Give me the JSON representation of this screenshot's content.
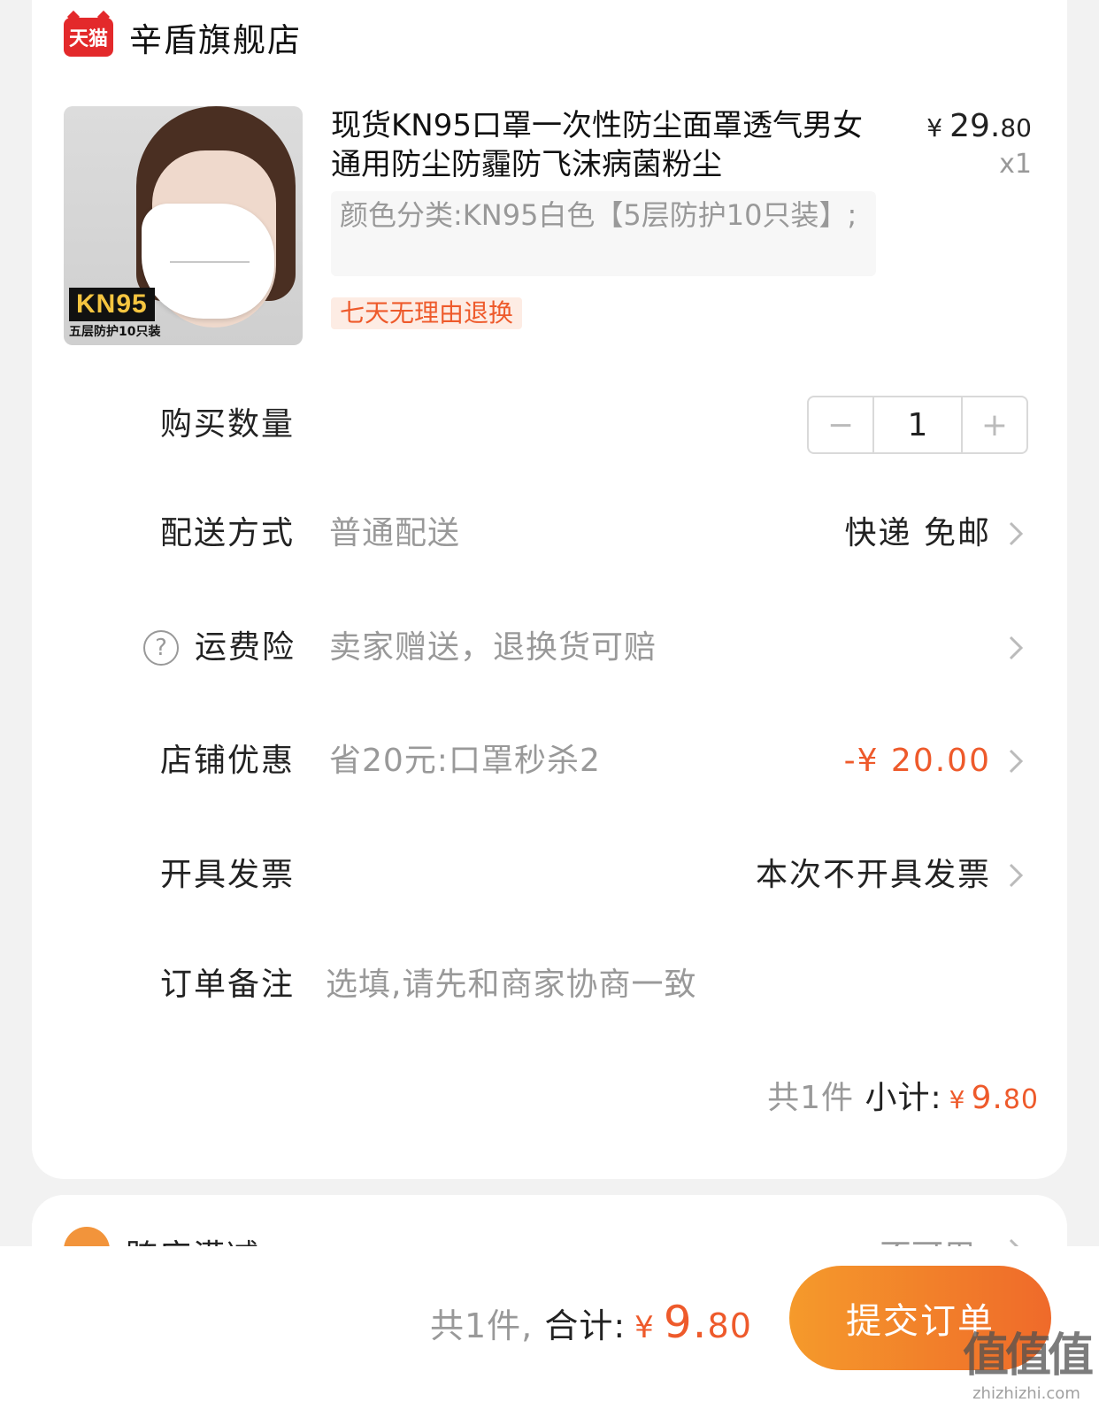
{
  "shop": {
    "badge": "天猫",
    "name": "辛盾旗舰店"
  },
  "product": {
    "title": "现货KN95口罩一次性防尘面罩透气男女通用防尘防霾防飞沫病菌粉尘",
    "image_badge": "KN95",
    "image_caption": "五层防护10只装",
    "price_currency": "¥",
    "price_int": "29.",
    "price_dec": "80",
    "quantity_label": "x1",
    "sku": "颜色分类:KN95白色【5层防护10只装】;",
    "return_tag": "七天无理由退换"
  },
  "quantity_row": {
    "label": "购买数量",
    "value": "1",
    "minus": "−",
    "plus": "+"
  },
  "delivery_row": {
    "label": "配送方式",
    "value": "普通配送",
    "right": "快递 免邮"
  },
  "insurance_row": {
    "label": "运费险",
    "value": "卖家赠送，退换货可赔",
    "help": "?"
  },
  "discount_row": {
    "label": "店铺优惠",
    "value": "省20元:口罩秒杀2",
    "right": "-¥ 20.00"
  },
  "invoice_row": {
    "label": "开具发票",
    "right": "本次不开具发票"
  },
  "note_row": {
    "label": "订单备注",
    "placeholder": "选填,请先和商家协商一致"
  },
  "subtotal": {
    "count_text": "共1件",
    "label": "小计:",
    "currency": "¥",
    "int": "9.",
    "dec": "80"
  },
  "cross_store": {
    "label": "跨店满减",
    "right": "不可用"
  },
  "bottom_bar": {
    "count_text": "共1件,",
    "label": "合计:",
    "currency": "¥",
    "int": "9.",
    "dec": "80",
    "submit_label": "提交订单"
  },
  "watermark": {
    "main": "值值值",
    "sub": "zhizhizhi.com"
  },
  "colors": {
    "accent": "#ee5a2b",
    "tmall_red": "#e3292b",
    "button_start": "#f59a2b",
    "button_end": "#ef6a2a"
  }
}
